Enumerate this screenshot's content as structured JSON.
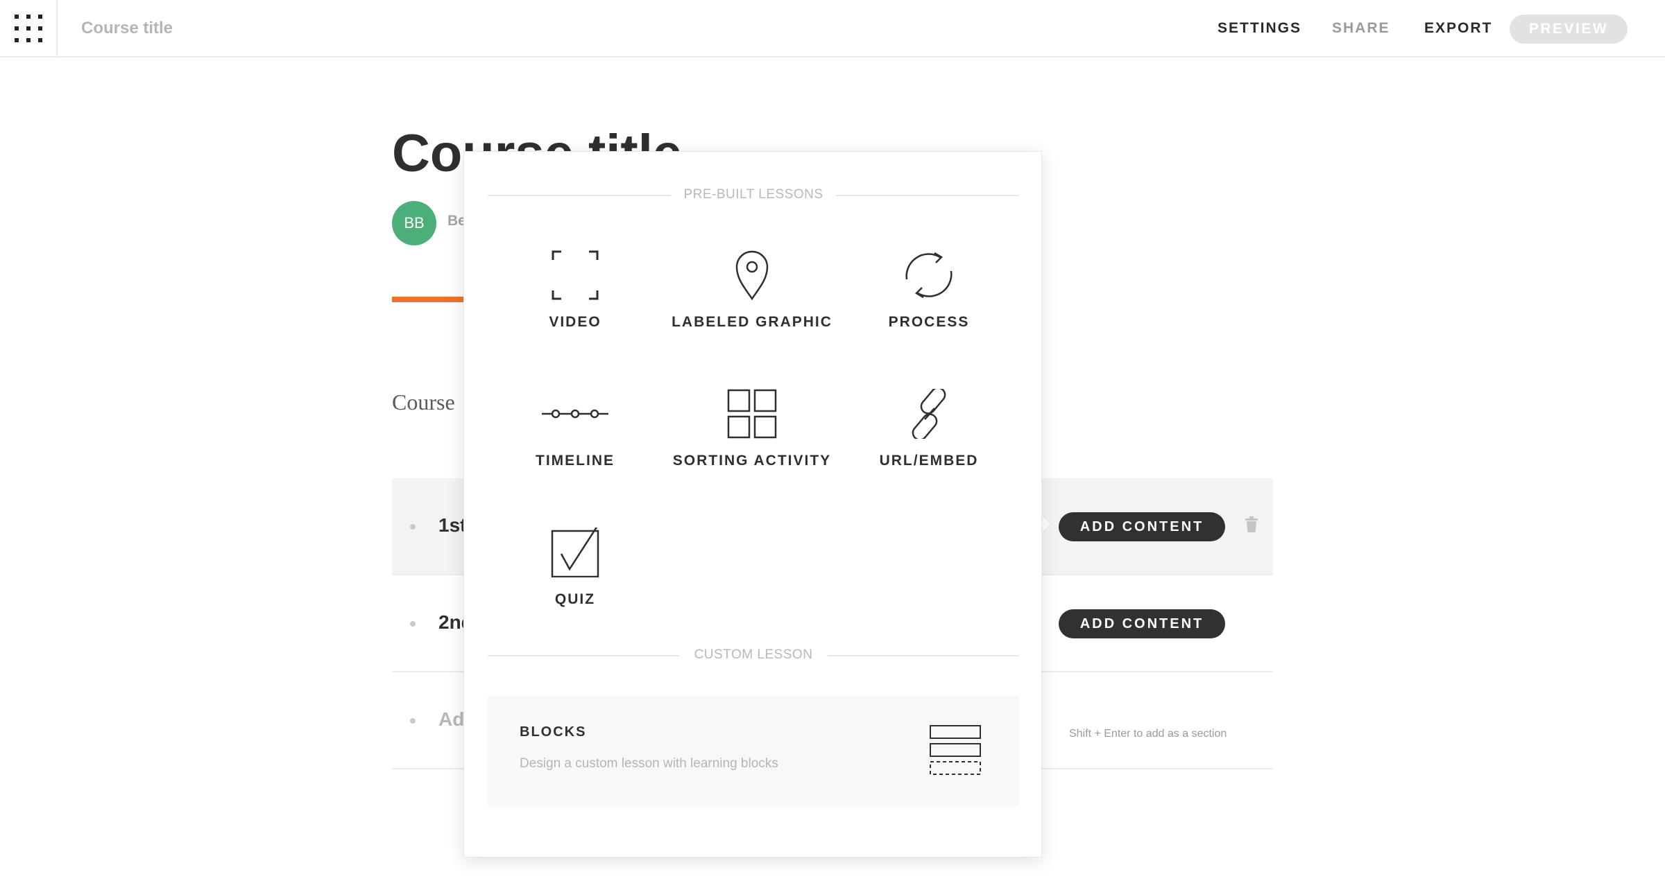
{
  "topbar": {
    "title": "Course title",
    "nav": {
      "settings": "SETTINGS",
      "share": "SHARE",
      "export": "EXPORT",
      "preview": "PREVIEW"
    },
    "menu_icon": "grid-menu-icon"
  },
  "course": {
    "heading": "Course title",
    "avatar_initials": "BB",
    "author": "Be",
    "description": "Course",
    "progress_color": "#f07029"
  },
  "lessons": [
    {
      "title": "1st",
      "button": "ADD CONTENT"
    },
    {
      "title": "2nd",
      "button": "ADD CONTENT"
    }
  ],
  "new_lesson": {
    "placeholder": "Add",
    "hint": "Shift + Enter to add as a section"
  },
  "popup": {
    "prebuilt_header": "PRE-BUILT LESSONS",
    "tiles": [
      {
        "label": "VIDEO",
        "icon": "video-frame-icon"
      },
      {
        "label": "LABELED GRAPHIC",
        "icon": "map-pin-icon"
      },
      {
        "label": "PROCESS",
        "icon": "refresh-cycle-icon"
      },
      {
        "label": "TIMELINE",
        "icon": "timeline-icon"
      },
      {
        "label": "SORTING ACTIVITY",
        "icon": "grid-squares-icon"
      },
      {
        "label": "URL/EMBED",
        "icon": "link-icon"
      },
      {
        "label": "QUIZ",
        "icon": "checkbox-icon"
      }
    ],
    "custom_header": "CUSTOM LESSON",
    "blocks": {
      "title": "BLOCKS",
      "description": "Design a custom lesson with learning blocks",
      "icon": "blocks-stack-icon"
    }
  },
  "colors": {
    "accent": "#f07029",
    "avatar": "#4caf7a",
    "dark_button": "#2f3133"
  }
}
